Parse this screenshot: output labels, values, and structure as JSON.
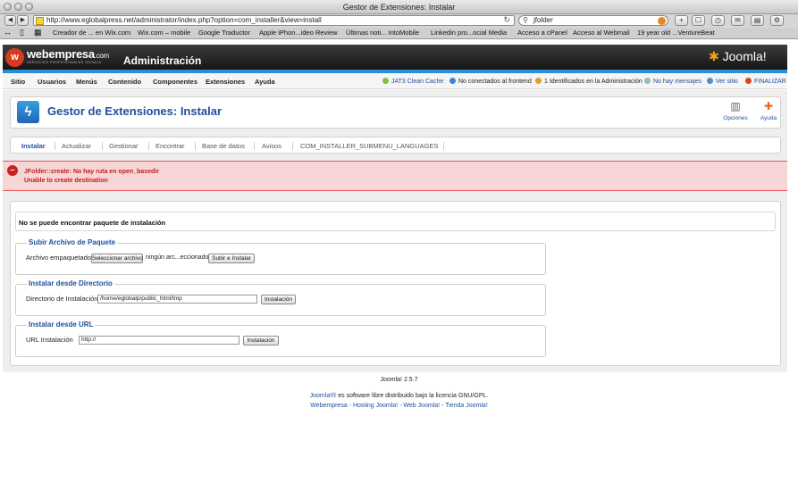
{
  "browser": {
    "window_title": "Gestor de Extensiones: Instalar",
    "url": "http://www.eglobalpress.net/administrator/index.php?option=com_installer&view=install",
    "search": "jfolder",
    "bookmarks": [
      "Creador de ... en Wix.com",
      "Wix.com – mobile",
      "Google Traductor",
      "Apple iPhon...ideo Review",
      "Últimas noti... IntoMobile",
      "Linkedin pro...ocial Media",
      "Acceso a cPanel",
      "Acceso al Webmail",
      "19 year old ...VentureBeat"
    ]
  },
  "header": {
    "brand": "webempresa",
    "brand_tld": ".com",
    "brand_sub": "SERVICIOS PROFESIONALES JOOMLA",
    "admin_title": "Administración",
    "joomla_logo": "Joomla!"
  },
  "menu": {
    "items": [
      "Sitio",
      "Usuarios",
      "Menús",
      "Contenido",
      "Componentes",
      "Extensiones",
      "Ayuda"
    ],
    "status": {
      "cache": "JAT3 Clean Cache",
      "frontend": "No conectados al frontend",
      "admin": "1 Identificados en la Administración",
      "messages": "No hay mensajes",
      "site": "Ver sitio",
      "logout": "FINALIZAR"
    }
  },
  "toolbar": {
    "page_title": "Gestor de Extensiones: Instalar",
    "options_label": "Opciones",
    "help_label": "Ayuda"
  },
  "submenu": [
    "Instalar",
    "Actualizar",
    "Gestionar",
    "Encontrar",
    "Base de datos",
    "Avisos",
    "COM_INSTALLER_SUBMENU_LANGUAGES"
  ],
  "error": {
    "line1": "JFolder::create: No hay ruta en open_basedir",
    "line2": "Unable to create destination"
  },
  "warning": "No se puede encontrar paquete de instalación",
  "upload": {
    "legend": "Subir Archivo de Paquete",
    "label": "Archivo empaquetado",
    "choose_button": "Seleccionar archivo",
    "file_status": "ningún arc...eccionado",
    "submit": "Subir e Instalar"
  },
  "directory": {
    "legend": "Instalar desde Directorio",
    "label": "Directorio de Instalación",
    "value": "/home/eglobalp/public_html/tmp",
    "submit": "Instalación"
  },
  "url_install": {
    "legend": "Instalar desde URL",
    "label": "URL Instalación",
    "value": "http://",
    "submit": "Instalación"
  },
  "footer": {
    "version": "Joomla! 2.5.7",
    "license_link": "Joomla!®",
    "license_text": " es software libre distribuido bajo la licencia GNU/GPL.",
    "links": "Webempresa - Hosting Joomla! - Web Joomla! - Tienda Joomla!"
  },
  "colors": {
    "accent_blue": "#1f4e9c",
    "error_red": "#c31d1d",
    "header_bar": "#2c8fd6"
  }
}
